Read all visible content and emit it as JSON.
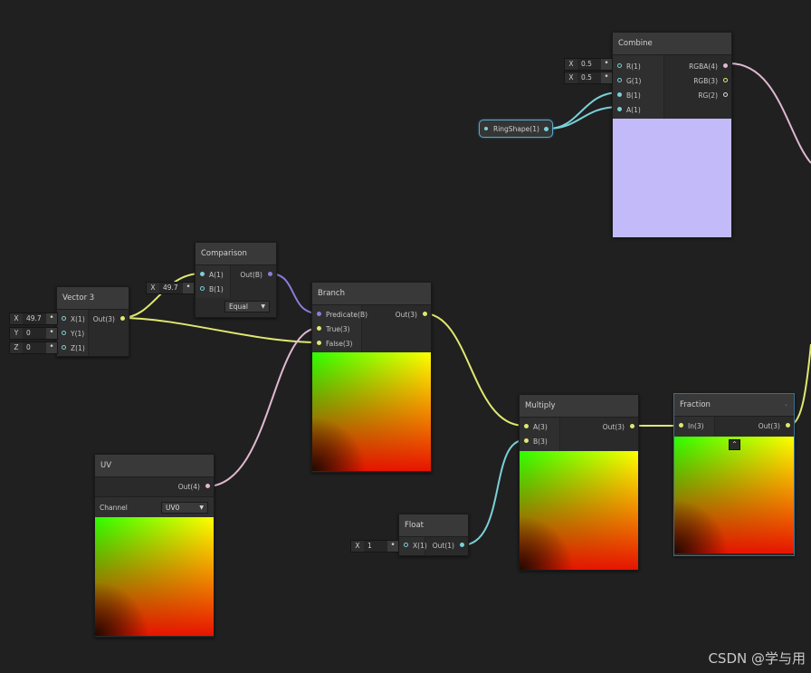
{
  "nodes": {
    "combine": {
      "title": "Combine",
      "inputs": [
        "R(1)",
        "G(1)",
        "B(1)",
        "A(1)"
      ],
      "outputs": [
        "RGBA(4)",
        "RGB(3)",
        "RG(2)"
      ],
      "preview_color": "#c3bafa"
    },
    "comparison": {
      "title": "Comparison",
      "inputs": [
        "A(1)",
        "B(1)"
      ],
      "outputs": [
        "Out(B)"
      ],
      "dropdown": "Equal"
    },
    "vector3": {
      "title": "Vector 3",
      "inputs": [
        "X(1)",
        "Y(1)",
        "Z(1)"
      ],
      "outputs": [
        "Out(3)"
      ]
    },
    "branch": {
      "title": "Branch",
      "inputs": [
        "Predicate(B)",
        "True(3)",
        "False(3)"
      ],
      "outputs": [
        "Out(3)"
      ]
    },
    "uv": {
      "title": "UV",
      "outputs": [
        "Out(4)"
      ],
      "channel_label": "Channel",
      "channel_value": "UV0"
    },
    "multiply": {
      "title": "Multiply",
      "inputs": [
        "A(3)",
        "B(3)"
      ],
      "outputs": [
        "Out(3)"
      ]
    },
    "float": {
      "title": "Float",
      "inputs": [
        "X(1)"
      ],
      "outputs": [
        "Out(1)"
      ]
    },
    "fraction": {
      "title": "Fraction",
      "inputs": [
        "In(3)"
      ],
      "outputs": [
        "Out(3)"
      ]
    }
  },
  "property_pill": {
    "label": "RingShape(1)"
  },
  "inline_fields": {
    "combine_r": {
      "axis": "X",
      "value": "0.5"
    },
    "combine_g": {
      "axis": "X",
      "value": "0.5"
    },
    "comparison_b": {
      "axis": "X",
      "value": "49.7"
    },
    "vector3_x": {
      "axis": "X",
      "value": "49.7"
    },
    "vector3_y": {
      "axis": "Y",
      "value": "0"
    },
    "vector3_z": {
      "axis": "Z",
      "value": "0"
    },
    "float_x": {
      "axis": "X",
      "value": "1"
    }
  },
  "watermark": "CSDN @学与用",
  "colors": {
    "canvas": "#202020",
    "port_vector1": "#7ad0d8",
    "port_vector3": "#e0e870",
    "port_bool": "#8b7ed8",
    "port_vector4": "#e0b8d0"
  }
}
